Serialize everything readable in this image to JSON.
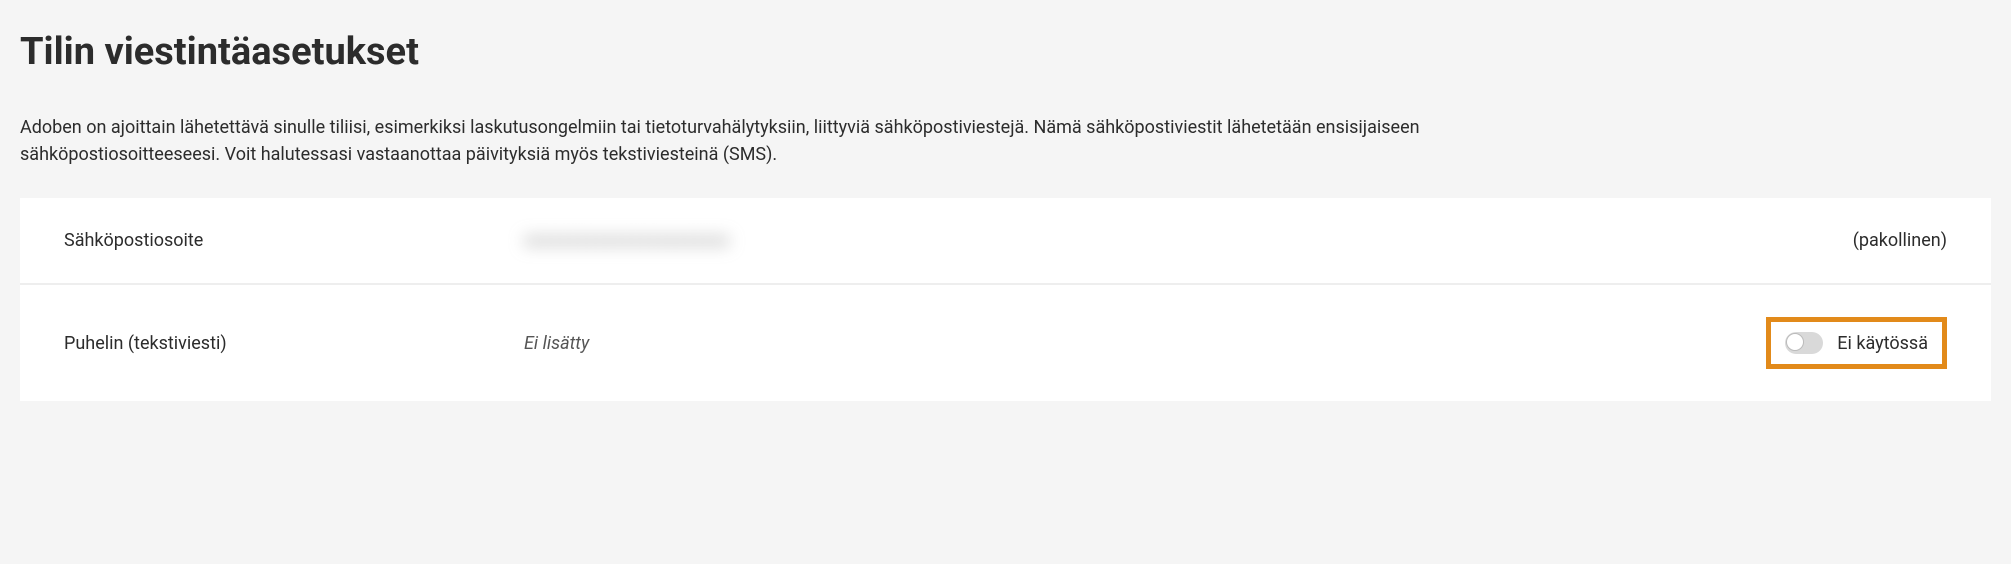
{
  "heading": "Tilin viestintäasetukset",
  "description": "Adoben on ajoittain lähetettävä sinulle tiliisi, esimerkiksi laskutusongelmiin tai tietoturvahälytyksiin, liittyviä sähköpostiviestejä. Nämä sähköpostiviestit lähetetään ensisijaiseen sähköpostiosoitteeseesi. Voit halutessasi vastaanottaa päivityksiä myös tekstiviesteinä (SMS).",
  "rows": {
    "email": {
      "label": "Sähköpostiosoite",
      "value": "xxxxxxxxxxxxxxxxxxxxxxx",
      "status": "(pakollinen)"
    },
    "phone": {
      "label": "Puhelin (tekstiviesti)",
      "value": "Ei lisätty",
      "toggle_state": "off",
      "toggle_label": "Ei käytössä"
    }
  }
}
